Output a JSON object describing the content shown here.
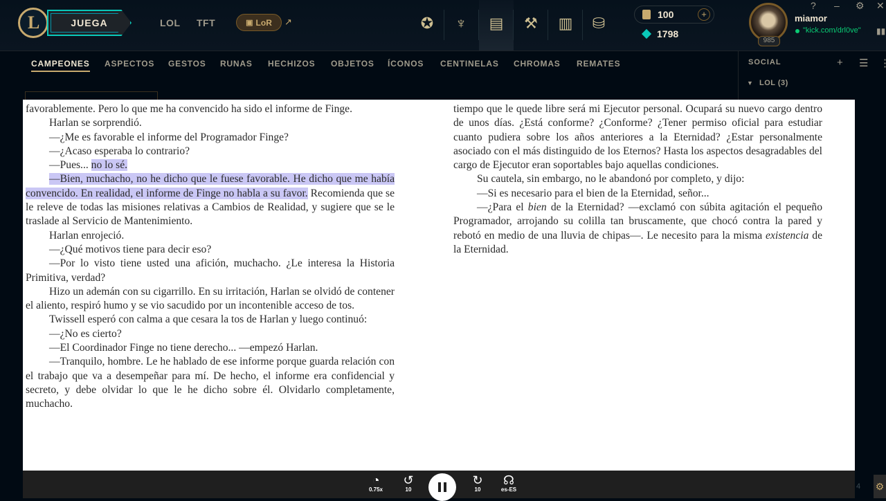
{
  "app": {
    "logo_letter": "L",
    "play_label": "JUEGA",
    "top_links": [
      "LOL",
      "TFT"
    ],
    "lor_label": "LoR",
    "external_icon": "external-link-icon",
    "nav_icons": [
      "trophy-icon",
      "clash-icon",
      "store-icon",
      "crafting-icon",
      "collection-icon",
      "loot-icon"
    ],
    "rp": "100",
    "be": "1798",
    "plus_label": "+",
    "sys_icons": [
      "help-icon",
      "minimize-icon",
      "settings-icon",
      "close-icon"
    ],
    "username": "miamor",
    "status": "\"kick.com/drl0ve\"",
    "level": "985"
  },
  "subnav": {
    "tabs": [
      "CAMPEONES",
      "ASPECTOS",
      "GESTOS",
      "RUNAS",
      "HECHIZOS",
      "OBJETOS",
      "ÍCONOS",
      "CENTINELAS",
      "CHROMAS",
      "REMATES"
    ],
    "active": "CAMPEONES"
  },
  "social": {
    "title": "SOCIAL",
    "group": "LOL (3)"
  },
  "document": {
    "left": [
      {
        "indent": false,
        "text": "favorablemente. Pero lo que me ha convencido ha sido el informe de Finge."
      },
      {
        "indent": true,
        "text": "Harlan se sorprendió."
      },
      {
        "indent": true,
        "text": "—¿Me es favorable el informe del Programador Finge?"
      },
      {
        "indent": true,
        "text": "—¿Acaso esperaba lo contrario?"
      },
      {
        "indent": true,
        "text": "—Pues... ",
        "hl": "no lo sé."
      },
      {
        "indent": true,
        "hl": "—Bien, muchacho, no he dicho que le fuese favorable. He dicho que me había convencido. En realidad, el informe de Finge no habla a su favor.",
        "text": " Recomienda que se le releve de todas las misiones relativas a Cambios de Realidad, y sugiere que se le traslade al Servicio de Mantenimiento."
      },
      {
        "indent": true,
        "text": "Harlan enrojeció."
      },
      {
        "indent": true,
        "text": "—¿Qué motivos tiene para decir eso?"
      },
      {
        "indent": true,
        "text": "—Por lo visto tiene usted una afición, muchacho. ¿Le interesa la Historia Primitiva, verdad?"
      },
      {
        "indent": true,
        "text": "Hizo un ademán con su cigarrillo. En su irritación, Harlan se olvidó de contener el aliento, respiró humo y se vio sacudido por un incontenible acceso de tos."
      },
      {
        "indent": true,
        "text": "Twissell esperó con calma a que cesara la tos de Harlan y luego continuó:"
      },
      {
        "indent": true,
        "text": "—¿No es cierto?"
      },
      {
        "indent": true,
        "text": "—El Coordinador Finge no tiene derecho... —empezó Harlan."
      },
      {
        "indent": true,
        "text": "—Tranquilo, hombre. Le he hablado de ese informe porque guarda relación con el trabajo que va a desempeñar para mí. De hecho, el informe era confidencial y secreto, y debe olvidar lo que le he dicho sobre él. Olvidarlo completamente, muchacho."
      }
    ],
    "right": [
      {
        "indent": false,
        "text": "tiempo que le quede libre será mi Ejecutor personal. Ocupará su nuevo cargo dentro de unos días. ¿Está conforme? ¿Conforme? ¿Tener permiso oficial para estudiar cuanto pudiera sobre los años anteriores a la Eternidad? ¿Estar personalmente asociado con el más distinguido de los Eternos? Hasta los aspectos desagradables del cargo de Ejecutor eran soportables bajo aquellas condiciones."
      },
      {
        "indent": true,
        "text": "Su cautela, sin embargo, no le abandonó por completo, y dijo:"
      },
      {
        "indent": true,
        "text": "—Si es necesario para el bien de la Eternidad, señor..."
      },
      {
        "indent": true,
        "text": "—¿Para el ",
        "em": "bien",
        "text2": " de la Eternidad? —exclamó con súbita agitación el pequeño Programador, arrojando su colilla tan bruscamente, que chocó contra la pared y rebotó en medio de una lluvia de chipas—. Le necesito para la misma ",
        "em2": "existencia",
        "text3": " de la Eternidad."
      }
    ]
  },
  "player": {
    "speed": "0.75x",
    "back": "10",
    "fwd": "10",
    "lang": "es-ES"
  },
  "colors": {
    "gold": "#c8aa6e",
    "teal": "#0ac8b9",
    "highlight": "#cac7f5",
    "online": "#0acb74"
  }
}
